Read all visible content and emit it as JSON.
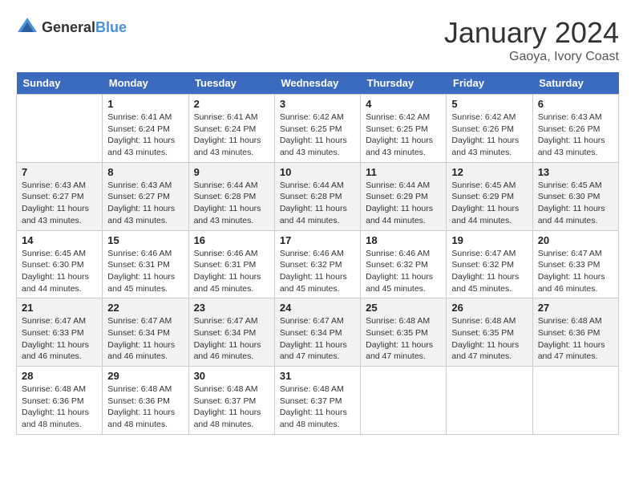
{
  "header": {
    "logo": {
      "text_general": "General",
      "text_blue": "Blue"
    },
    "title": "January 2024",
    "location": "Gaoya, Ivory Coast"
  },
  "days_of_week": [
    "Sunday",
    "Monday",
    "Tuesday",
    "Wednesday",
    "Thursday",
    "Friday",
    "Saturday"
  ],
  "weeks": [
    [
      {
        "day": "",
        "info": ""
      },
      {
        "day": "1",
        "info": "Sunrise: 6:41 AM\nSunset: 6:24 PM\nDaylight: 11 hours and 43 minutes."
      },
      {
        "day": "2",
        "info": "Sunrise: 6:41 AM\nSunset: 6:24 PM\nDaylight: 11 hours and 43 minutes."
      },
      {
        "day": "3",
        "info": "Sunrise: 6:42 AM\nSunset: 6:25 PM\nDaylight: 11 hours and 43 minutes."
      },
      {
        "day": "4",
        "info": "Sunrise: 6:42 AM\nSunset: 6:25 PM\nDaylight: 11 hours and 43 minutes."
      },
      {
        "day": "5",
        "info": "Sunrise: 6:42 AM\nSunset: 6:26 PM\nDaylight: 11 hours and 43 minutes."
      },
      {
        "day": "6",
        "info": "Sunrise: 6:43 AM\nSunset: 6:26 PM\nDaylight: 11 hours and 43 minutes."
      }
    ],
    [
      {
        "day": "7",
        "info": "Sunrise: 6:43 AM\nSunset: 6:27 PM\nDaylight: 11 hours and 43 minutes."
      },
      {
        "day": "8",
        "info": "Sunrise: 6:43 AM\nSunset: 6:27 PM\nDaylight: 11 hours and 43 minutes."
      },
      {
        "day": "9",
        "info": "Sunrise: 6:44 AM\nSunset: 6:28 PM\nDaylight: 11 hours and 43 minutes."
      },
      {
        "day": "10",
        "info": "Sunrise: 6:44 AM\nSunset: 6:28 PM\nDaylight: 11 hours and 44 minutes."
      },
      {
        "day": "11",
        "info": "Sunrise: 6:44 AM\nSunset: 6:29 PM\nDaylight: 11 hours and 44 minutes."
      },
      {
        "day": "12",
        "info": "Sunrise: 6:45 AM\nSunset: 6:29 PM\nDaylight: 11 hours and 44 minutes."
      },
      {
        "day": "13",
        "info": "Sunrise: 6:45 AM\nSunset: 6:30 PM\nDaylight: 11 hours and 44 minutes."
      }
    ],
    [
      {
        "day": "14",
        "info": "Sunrise: 6:45 AM\nSunset: 6:30 PM\nDaylight: 11 hours and 44 minutes."
      },
      {
        "day": "15",
        "info": "Sunrise: 6:46 AM\nSunset: 6:31 PM\nDaylight: 11 hours and 45 minutes."
      },
      {
        "day": "16",
        "info": "Sunrise: 6:46 AM\nSunset: 6:31 PM\nDaylight: 11 hours and 45 minutes."
      },
      {
        "day": "17",
        "info": "Sunrise: 6:46 AM\nSunset: 6:32 PM\nDaylight: 11 hours and 45 minutes."
      },
      {
        "day": "18",
        "info": "Sunrise: 6:46 AM\nSunset: 6:32 PM\nDaylight: 11 hours and 45 minutes."
      },
      {
        "day": "19",
        "info": "Sunrise: 6:47 AM\nSunset: 6:32 PM\nDaylight: 11 hours and 45 minutes."
      },
      {
        "day": "20",
        "info": "Sunrise: 6:47 AM\nSunset: 6:33 PM\nDaylight: 11 hours and 46 minutes."
      }
    ],
    [
      {
        "day": "21",
        "info": "Sunrise: 6:47 AM\nSunset: 6:33 PM\nDaylight: 11 hours and 46 minutes."
      },
      {
        "day": "22",
        "info": "Sunrise: 6:47 AM\nSunset: 6:34 PM\nDaylight: 11 hours and 46 minutes."
      },
      {
        "day": "23",
        "info": "Sunrise: 6:47 AM\nSunset: 6:34 PM\nDaylight: 11 hours and 46 minutes."
      },
      {
        "day": "24",
        "info": "Sunrise: 6:47 AM\nSunset: 6:34 PM\nDaylight: 11 hours and 47 minutes."
      },
      {
        "day": "25",
        "info": "Sunrise: 6:48 AM\nSunset: 6:35 PM\nDaylight: 11 hours and 47 minutes."
      },
      {
        "day": "26",
        "info": "Sunrise: 6:48 AM\nSunset: 6:35 PM\nDaylight: 11 hours and 47 minutes."
      },
      {
        "day": "27",
        "info": "Sunrise: 6:48 AM\nSunset: 6:36 PM\nDaylight: 11 hours and 47 minutes."
      }
    ],
    [
      {
        "day": "28",
        "info": "Sunrise: 6:48 AM\nSunset: 6:36 PM\nDaylight: 11 hours and 48 minutes."
      },
      {
        "day": "29",
        "info": "Sunrise: 6:48 AM\nSunset: 6:36 PM\nDaylight: 11 hours and 48 minutes."
      },
      {
        "day": "30",
        "info": "Sunrise: 6:48 AM\nSunset: 6:37 PM\nDaylight: 11 hours and 48 minutes."
      },
      {
        "day": "31",
        "info": "Sunrise: 6:48 AM\nSunset: 6:37 PM\nDaylight: 11 hours and 48 minutes."
      },
      {
        "day": "",
        "info": ""
      },
      {
        "day": "",
        "info": ""
      },
      {
        "day": "",
        "info": ""
      }
    ]
  ]
}
